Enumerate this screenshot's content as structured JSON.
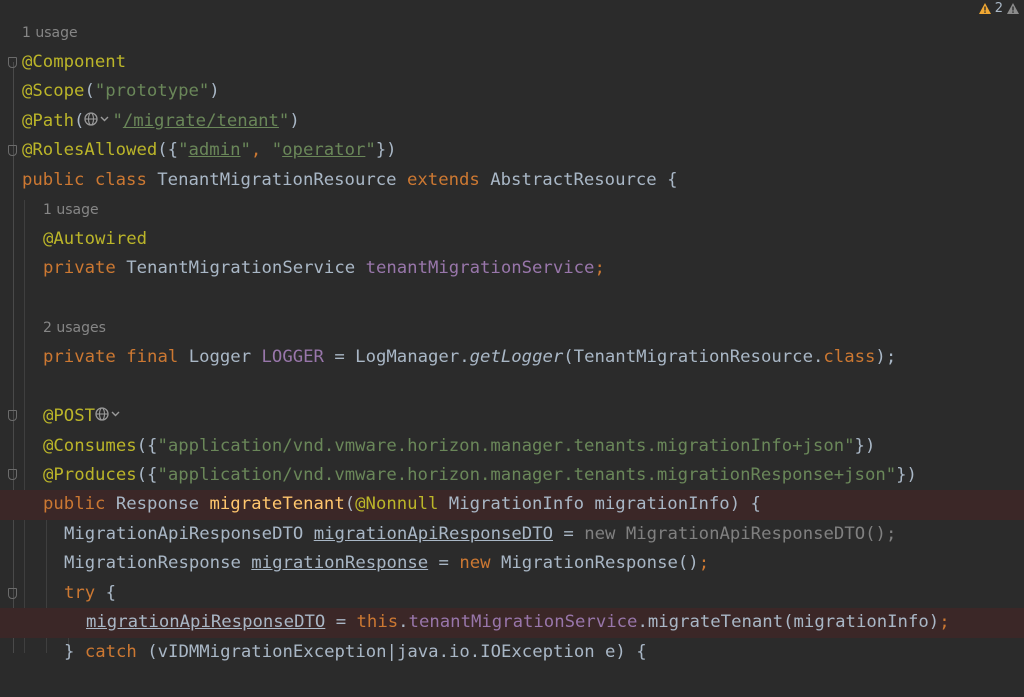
{
  "inspections": {
    "warning_count": "2"
  },
  "usages": {
    "class": "1 usage",
    "field": "1 usage",
    "logger": "2 usages"
  },
  "code": {
    "ann_component": "@Component",
    "ann_scope": "@Scope",
    "scope_open": "(",
    "scope_value": "\"prototype\"",
    "scope_close": ")",
    "ann_path": "@Path",
    "path_open": "(",
    "path_q1": "\"",
    "path_value": "/migrate/tenant",
    "path_q2": "\"",
    "path_close": ")",
    "ann_roles": "@RolesAllowed",
    "roles_open": "({",
    "roles_q1": "\"",
    "roles_admin": "admin",
    "roles_q2": "\"",
    "roles_comma": ", ",
    "roles_q3": "\"",
    "roles_operator": "operator",
    "roles_q4": "\"",
    "roles_close": "})",
    "kw_public": "public",
    "kw_class": "class",
    "class_name": "TenantMigrationResource",
    "kw_extends": "extends",
    "super_class": "AbstractResource",
    "class_brace": " {",
    "ann_autowired": "@Autowired",
    "kw_private": "private",
    "field_type": "TenantMigrationService",
    "field_name": "tenantMigrationService",
    "semicolon": ";",
    "kw_private2": "private",
    "kw_final": "final",
    "logger_type": "Logger",
    "logger_name": "LOGGER",
    "assign": " = LogManager.",
    "get_logger": "getLogger",
    "get_logger_args": "(TenantMigrationResource.",
    "kw_class2": "class",
    "get_logger_end": ");",
    "ann_post": "@POST",
    "ann_consumes": "@Consumes",
    "consumes_open": "({",
    "consumes_value": "\"application/vnd.vmware.horizon.manager.tenants.migrationInfo+json\"",
    "consumes_close": "})",
    "ann_produces": "@Produces",
    "produces_open": "({",
    "produces_value": "\"application/vnd.vmware.horizon.manager.tenants.migrationResponse+json\"",
    "produces_close": "})",
    "kw_public2": "public",
    "resp_type": "Response",
    "method_name": "migrateTenant",
    "method_open": "(",
    "ann_nonnull": "@Nonnull",
    "param": "MigrationInfo migrationInfo) {",
    "dto_type": "MigrationApiResponseDTO",
    "dto_var": "migrationApiResponseDTO",
    "dto_assign": " = ",
    "dto_new": "new MigrationApiResponseDTO();",
    "mr_type": "MigrationResponse",
    "mr_var": "migrationResponse",
    "mr_assign": " = ",
    "kw_new": "new",
    "mr_ctor": "MigrationResponse()",
    "mr_semi": ";",
    "kw_try": "try",
    "try_brace": " {",
    "call_var": "migrationApiResponseDTO",
    "call_assign": " = ",
    "kw_this": "this",
    "call_dot": ".",
    "call_field": "tenantMigrationService",
    "call_rest": ".migrateTenant(migrationInfo)",
    "call_semi": ";",
    "catch_brace": "} ",
    "kw_catch": "catch",
    "catch_rest": " (vIDMMigrationException|java.io.IOException e) {"
  },
  "colors": {
    "background": "#2b2b2b",
    "keyword": "#cc7832",
    "annotation": "#bbb529",
    "string": "#6a8759",
    "field": "#9876aa",
    "method": "#ffc66d",
    "text": "#a9b7c6",
    "highlight_line": "#3b2727",
    "warning": "#f0a732"
  },
  "icons": {
    "warning": "warning-triangle-icon",
    "web_hint": "globe-dropdown-icon",
    "fold": "fold-marker-icon"
  }
}
